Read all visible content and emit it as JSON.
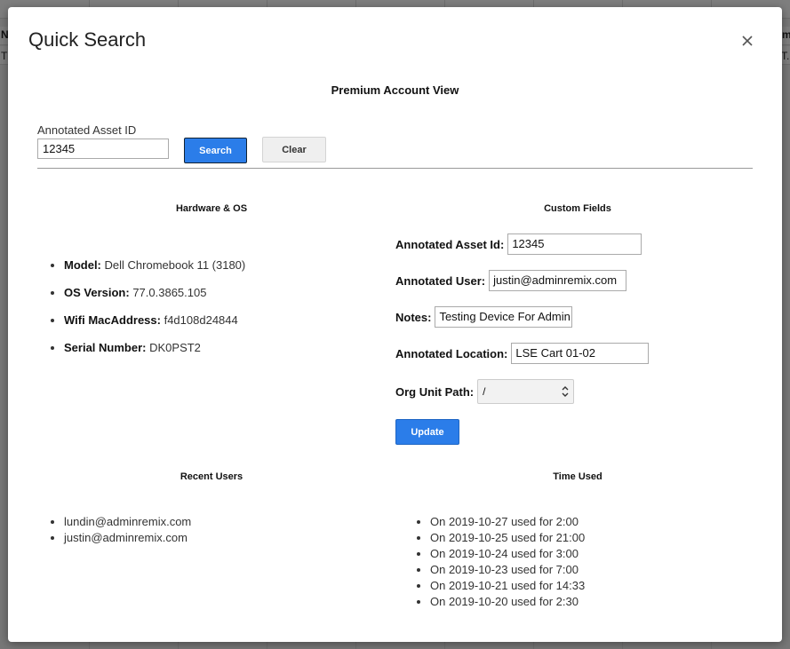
{
  "modal": {
    "title": "Quick Search",
    "close_icon": "close-icon"
  },
  "background": {
    "edge_left_top": "N",
    "edge_left_bottom": "T",
    "edge_right_top": "m",
    "edge_right_bottom": "T."
  },
  "account_view": {
    "heading": "Premium Account View"
  },
  "search": {
    "label": "Annotated Asset ID",
    "value": "12345",
    "search_label": "Search",
    "clear_label": "Clear"
  },
  "hardware": {
    "heading": "Hardware & OS",
    "items": [
      {
        "label": "Model:",
        "value": "Dell Chromebook 11 (3180)"
      },
      {
        "label": "OS Version:",
        "value": "77.0.3865.105"
      },
      {
        "label": "Wifi MacAddress:",
        "value": "f4d108d24844"
      },
      {
        "label": "Serial Number:",
        "value": "DK0PST2"
      }
    ]
  },
  "custom_fields": {
    "heading": "Custom Fields",
    "asset_id_label": "Annotated Asset Id:",
    "asset_id_value": "12345",
    "user_label": "Annotated User:",
    "user_value": "justin@adminremix.com",
    "notes_label": "Notes:",
    "notes_value": "Testing Device For Admin",
    "location_label": "Annotated Location:",
    "location_value": "LSE Cart 01-02",
    "org_unit_label": "Org Unit Path:",
    "org_unit_value": "/",
    "update_label": "Update"
  },
  "recent_users": {
    "heading": "Recent Users",
    "items": [
      "lundin@adminremix.com",
      "justin@adminremix.com"
    ]
  },
  "time_used": {
    "heading": "Time Used",
    "items": [
      "On 2019-10-27 used for 2:00",
      "On 2019-10-25 used for 21:00",
      "On 2019-10-24 used for 3:00",
      "On 2019-10-23 used for 7:00",
      "On 2019-10-21 used for 14:33",
      "On 2019-10-20 used for 2:30"
    ]
  }
}
